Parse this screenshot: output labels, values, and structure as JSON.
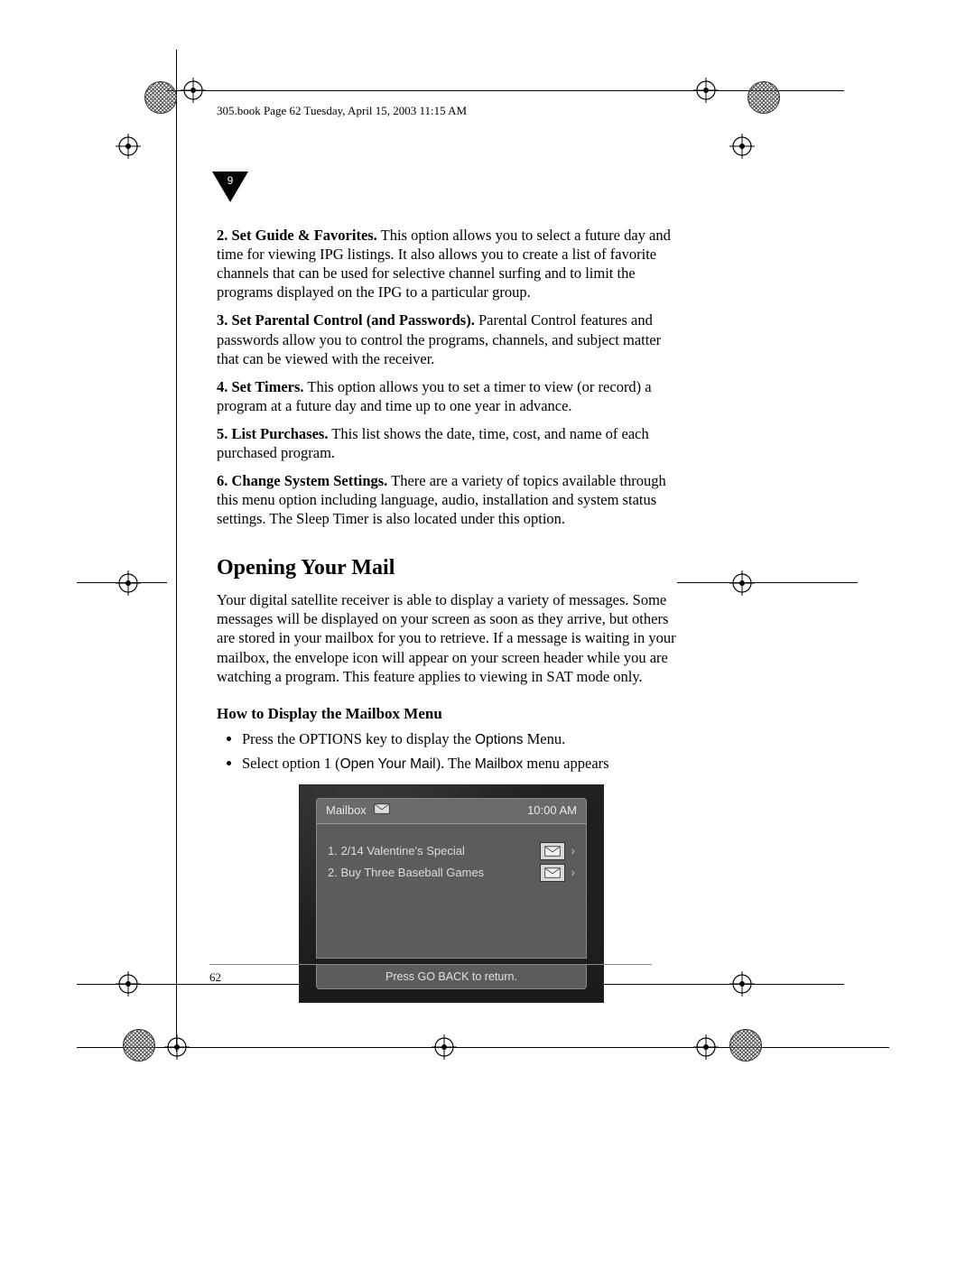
{
  "header": {
    "running": "305.book  Page 62  Tuesday, April 15, 2003  11:15 AM"
  },
  "chapter": {
    "number": "9"
  },
  "options": [
    {
      "lead": "2. Set Guide & Favorites.",
      "text": " This option allows you to select a future day and time for viewing IPG listings. It also allows you to create a list of favorite channels that can be used for selective channel surfing and to limit the programs displayed on the IPG to a particular group."
    },
    {
      "lead": "3. Set Parental Control (and Passwords).",
      "text": " Parental Control features and passwords allow you to control the programs, channels, and subject matter that can be viewed with the receiver."
    },
    {
      "lead": "4. Set Timers.",
      "text": " This option allows you to set a timer to view (or record) a program at a future day and time up to one year in advance."
    },
    {
      "lead": "5. List Purchases.",
      "text": " This list shows the date, time, cost, and name of each purchased program."
    },
    {
      "lead": "6. Change System Settings.",
      "text": " There are a variety of topics available through this menu option including language, audio, installation and system status settings. The Sleep Timer is also located under this option."
    }
  ],
  "section": {
    "title": "Opening Your Mail",
    "intro": "Your digital satellite receiver is able to display a variety of messages. Some messages will be displayed on your screen as soon as they arrive, but others are stored in your mailbox for you to retrieve. If a message is waiting in your mailbox, the envelope icon will appear on your screen header while you are watching a program. This feature applies to viewing in SAT mode only."
  },
  "howto": {
    "title": "How to Display the Mailbox Menu",
    "b1_pre": "Press the OPTIONS key to display the ",
    "b1_sans": "Options",
    "b1_post": " Menu.",
    "b2_pre": "Select option 1 (",
    "b2_sans1": "Open Your Mail",
    "b2_mid": "). The ",
    "b2_sans2": "Mailbox",
    "b2_post": " menu appears"
  },
  "mailbox": {
    "title": "Mailbox",
    "time": "10:00 AM",
    "items": [
      "1. 2/14 Valentine's Special",
      "2. Buy Three Baseball Games"
    ],
    "footer": "Press GO BACK to return."
  },
  "page_number": "62"
}
